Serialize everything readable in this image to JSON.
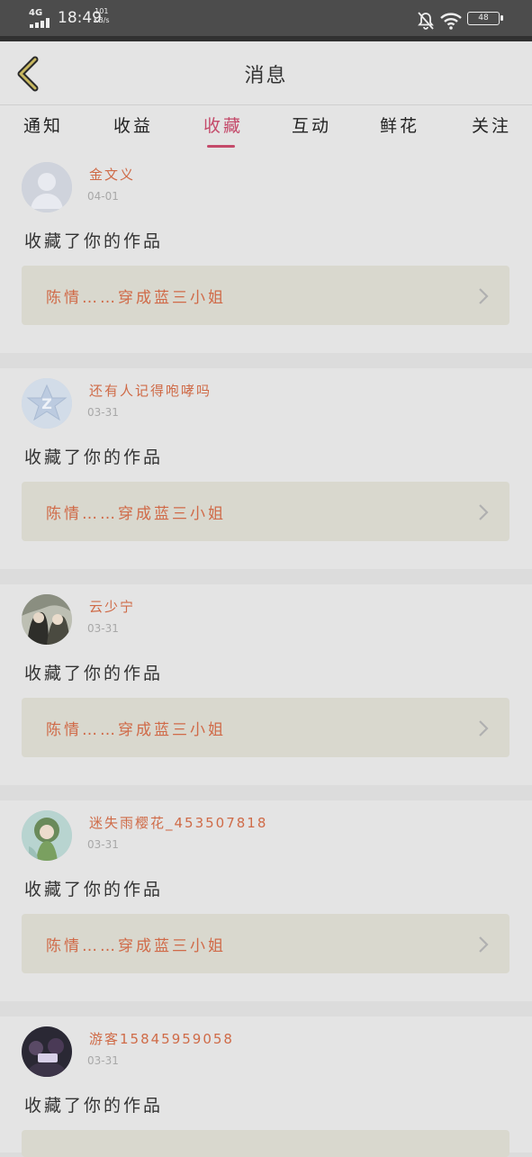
{
  "status_bar": {
    "network": "4G",
    "time": "18:49",
    "speed_value": "101",
    "speed_unit": "KB/s",
    "battery": "48"
  },
  "header": {
    "title": "消息"
  },
  "tabs": [
    {
      "label": "通知",
      "active": false
    },
    {
      "label": "收益",
      "active": false
    },
    {
      "label": "收藏",
      "active": true
    },
    {
      "label": "互动",
      "active": false
    },
    {
      "label": "鲜花",
      "active": false
    },
    {
      "label": "关注",
      "active": false
    }
  ],
  "messages": [
    {
      "user": "金文义",
      "date": "04-01",
      "text": "收藏了你的作品",
      "work": "陈情……穿成蓝三小姐",
      "avatar": "default-avatar-icon"
    },
    {
      "user": "还有人记得咆哮吗",
      "date": "03-31",
      "text": "收藏了你的作品",
      "work": "陈情……穿成蓝三小姐",
      "avatar": "star-z-avatar-icon"
    },
    {
      "user": "云少宁",
      "date": "03-31",
      "text": "收藏了你的作品",
      "work": "陈情……穿成蓝三小姐",
      "avatar": "anime-pair-avatar"
    },
    {
      "user": "迷失雨樱花_453507818",
      "date": "03-31",
      "text": "收藏了你的作品",
      "work": "陈情……穿成蓝三小姐",
      "avatar": "anime-girl-avatar"
    },
    {
      "user": "游客15845959058",
      "date": "03-31",
      "text": "收藏了你的作品",
      "work": "",
      "avatar": "dark-photo-avatar"
    }
  ],
  "colors": {
    "accent": "#c44a6a",
    "username": "#cf6b48",
    "card_bg": "#e4e4e4",
    "page_bg": "#dcdcdc"
  }
}
